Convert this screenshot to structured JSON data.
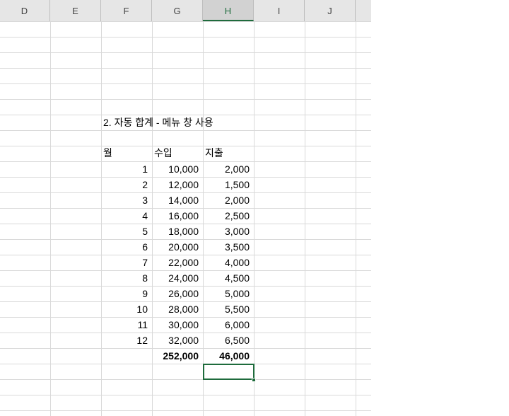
{
  "columns": [
    {
      "label": "D",
      "active": false
    },
    {
      "label": "E",
      "active": false
    },
    {
      "label": "F",
      "active": false
    },
    {
      "label": "G",
      "active": false
    },
    {
      "label": "H",
      "active": true
    },
    {
      "label": "I",
      "active": false
    },
    {
      "label": "J",
      "active": false
    }
  ],
  "title": "2. 자동 합계 - 메뉴 창 사용",
  "headers": {
    "month": "월",
    "income": "수입",
    "expense": "지출"
  },
  "rows": [
    {
      "month": "1",
      "income": "10,000",
      "expense": "2,000"
    },
    {
      "month": "2",
      "income": "12,000",
      "expense": "1,500"
    },
    {
      "month": "3",
      "income": "14,000",
      "expense": "2,000"
    },
    {
      "month": "4",
      "income": "16,000",
      "expense": "2,500"
    },
    {
      "month": "5",
      "income": "18,000",
      "expense": "3,000"
    },
    {
      "month": "6",
      "income": "20,000",
      "expense": "3,500"
    },
    {
      "month": "7",
      "income": "22,000",
      "expense": "4,000"
    },
    {
      "month": "8",
      "income": "24,000",
      "expense": "4,500"
    },
    {
      "month": "9",
      "income": "26,000",
      "expense": "5,000"
    },
    {
      "month": "10",
      "income": "28,000",
      "expense": "5,500"
    },
    {
      "month": "11",
      "income": "30,000",
      "expense": "6,000"
    },
    {
      "month": "12",
      "income": "32,000",
      "expense": "6,500"
    }
  ],
  "totals": {
    "income": "252,000",
    "expense": "46,000"
  },
  "selected_cell": "H22",
  "accent_color": "#1e6b3c"
}
